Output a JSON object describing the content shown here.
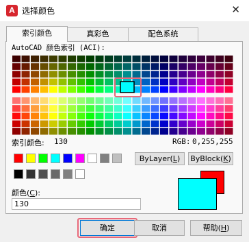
{
  "window": {
    "title": "选择颜色",
    "icon_letter": "A",
    "close_glyph": "✕"
  },
  "tabs": [
    {
      "label": "索引颜色",
      "active": true
    },
    {
      "label": "真彩色",
      "active": false
    },
    {
      "label": "配色系统",
      "active": false
    }
  ],
  "aci": {
    "heading": "AutoCAD 颜色索引 (ACI):",
    "index_label": "索引颜色:",
    "index_value": "130",
    "rgb_label": "RGB:",
    "rgb_value": "0,255,255",
    "selected_color": "#00ffff"
  },
  "standard_colors": [
    "#ff0000",
    "#ffff00",
    "#00ff00",
    "#00ffff",
    "#0000ff",
    "#ff00ff",
    "#ffffff",
    "#808080",
    "#c0c0c0"
  ],
  "gray_colors": [
    "#000000",
    "#333333",
    "#505050",
    "#696969",
    "#808080",
    "#ffffff"
  ],
  "buttons": {
    "bylayer": {
      "text": "ByLayer",
      "key": "L"
    },
    "byblock": {
      "text": "ByBlock",
      "key": "K"
    }
  },
  "color_field": {
    "label": "颜色",
    "key": "C",
    "value": "130"
  },
  "preview": {
    "old_color": "#ff0000",
    "new_color": "#00ffff"
  },
  "footer": {
    "ok": "确定",
    "cancel": "取消",
    "help": "帮助",
    "help_key": "H"
  }
}
